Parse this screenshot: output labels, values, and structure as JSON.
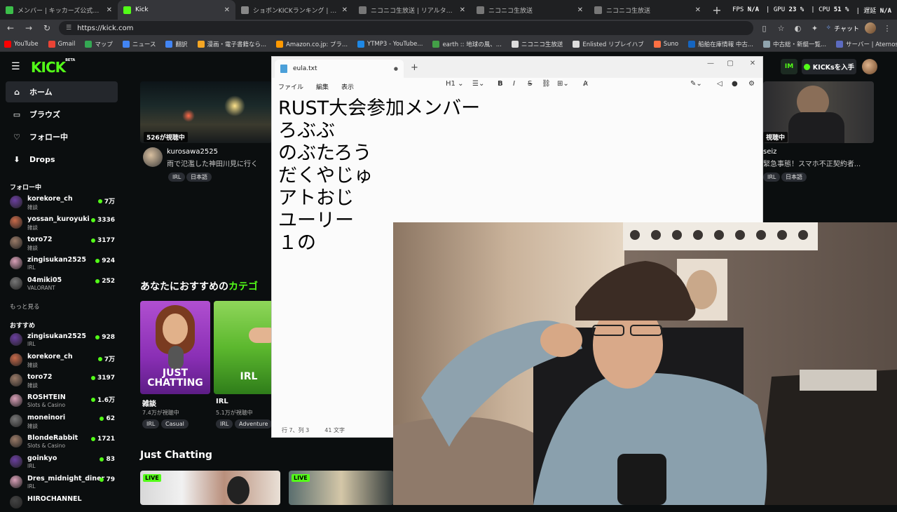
{
  "browser": {
    "tabs": [
      {
        "label": "メンバー | キッカーズ公式サイト",
        "color": "#3cbf4a",
        "active": false
      },
      {
        "label": "Kick",
        "color": "#53fc18",
        "active": true
      },
      {
        "label": "ショボンKICKランキング | Shobon Kick",
        "color": "#888888",
        "active": false
      },
      {
        "label": "ニコニコ生放送 | リアルタイムランキング",
        "color": "#777777",
        "active": false
      },
      {
        "label": "ニコニコ生放送",
        "color": "#777777",
        "active": false
      },
      {
        "label": "ニコニコ生放送",
        "color": "#777777",
        "active": false
      }
    ],
    "new_tab": "+",
    "stats": {
      "fps_label": "FPS",
      "fps_value": "N/A",
      "gpu_label": "GPU",
      "gpu_value": "23 %",
      "cpu_label": "CPU",
      "cpu_value": "51 %",
      "delay_label": "遅延",
      "delay_value": "N/A"
    },
    "url": "https://kick.com",
    "chat_label": "チャット",
    "bookmarks": [
      {
        "label": "YouTube",
        "color": "#ff0000"
      },
      {
        "label": "Gmail",
        "color": "#ea4335"
      },
      {
        "label": "マップ",
        "color": "#34a853"
      },
      {
        "label": "ニュース",
        "color": "#4285f4"
      },
      {
        "label": "翻訳",
        "color": "#4285f4"
      },
      {
        "label": "漫画・電子書籍なら...",
        "color": "#f5a623"
      },
      {
        "label": "Amazon.co.jp: プラ...",
        "color": "#ff9900"
      },
      {
        "label": "YTMP3 - YouTube...",
        "color": "#1e88e5"
      },
      {
        "label": "earth :: 地球の風、...",
        "color": "#43a047"
      },
      {
        "label": "ニコニコ生放送",
        "color": "#dddddd"
      },
      {
        "label": "Enlisted リプレイハブ",
        "color": "#dddddd"
      },
      {
        "label": "Suno",
        "color": "#ff7043"
      },
      {
        "label": "船舶在庫情報 中古...",
        "color": "#1565c0"
      },
      {
        "label": "中古総・新艇一覧...",
        "color": "#90a4ae"
      },
      {
        "label": "サーバー | Aternos |...",
        "color": "#5c6bc0"
      }
    ]
  },
  "kick": {
    "logo": "KICK",
    "logo_beta": "BETA",
    "kicks_label": "KICKsを入手",
    "im_badge": "IM",
    "nav": [
      {
        "label": "ホーム",
        "icon": "⌂",
        "active": true
      },
      {
        "label": "ブラウズ",
        "icon": "▭",
        "active": false
      },
      {
        "label": "フォロー中",
        "icon": "♡",
        "active": false
      },
      {
        "label": "Drops",
        "icon": "⬇",
        "active": false
      }
    ],
    "following_heading": "フォロー中",
    "following": [
      {
        "name": "korekore_ch",
        "cat": "雑談",
        "count": "7万"
      },
      {
        "name": "yossan_kuroyuki",
        "cat": "雑談",
        "count": "3336"
      },
      {
        "name": "toro72",
        "cat": "雑談",
        "count": "3177"
      },
      {
        "name": "zingisukan2525",
        "cat": "IRL",
        "count": "924"
      },
      {
        "name": "04miki05",
        "cat": "VALORANT",
        "count": "252"
      }
    ],
    "more_label": "もっと見る",
    "recommended_heading": "おすすめ",
    "recommended": [
      {
        "name": "zingisukan2525",
        "cat": "IRL",
        "count": "928"
      },
      {
        "name": "korekore_ch",
        "cat": "雑談",
        "count": "7万"
      },
      {
        "name": "toro72",
        "cat": "雑談",
        "count": "3197"
      },
      {
        "name": "ROSHTEIN",
        "cat": "Slots & Casino",
        "count": "1.6万"
      },
      {
        "name": "moneinori",
        "cat": "雑談",
        "count": "62"
      },
      {
        "name": "BlondeRabbit",
        "cat": "Slots & Casino",
        "count": "1721"
      },
      {
        "name": "goinkyo",
        "cat": "IRL",
        "count": "83"
      },
      {
        "name": "Dres_midnight_diner",
        "cat": "IRL",
        "count": "79"
      },
      {
        "name": "HIROCHANNEL",
        "cat": "",
        "count": ""
      }
    ],
    "featured": {
      "viewers": "526が視聴中",
      "channel": "kurosawa2525",
      "title": "雨で氾濫した神田川見に行く",
      "tags": [
        "IRL",
        "日本語"
      ]
    },
    "featured_right": {
      "viewers": "視聴中",
      "channel": "seiz",
      "title": "緊急事態！スマホ不正契約者...",
      "tags": [
        "IRL",
        "日本語"
      ]
    },
    "categories_title_a": "あなたにおすすめの",
    "categories_title_b": "カテゴ",
    "categories": [
      {
        "label": "JUST CHATTING",
        "name": "雑談",
        "viewers": "7.4万が視聴中",
        "tags": [
          "IRL",
          "Casual"
        ]
      },
      {
        "label": "IRL",
        "name": "IRL",
        "viewers": "5.1万が視聴中",
        "tags": [
          "IRL",
          "Adventure"
        ]
      }
    ],
    "just_chatting_title": "Just Chatting",
    "live_label": "LIVE"
  },
  "notepad": {
    "tab_title": "eula.txt",
    "menus": [
      "ファイル",
      "編集",
      "表示"
    ],
    "heading_select": "H1",
    "lines": [
      "RUST大会参加メンバー",
      "ろぶぶ",
      "のぶたろう",
      "だくやじゅ",
      "アトおじ",
      "ユーリー",
      "１の"
    ],
    "status_pos": "行 7、列 3",
    "status_chars": "41 文字"
  }
}
